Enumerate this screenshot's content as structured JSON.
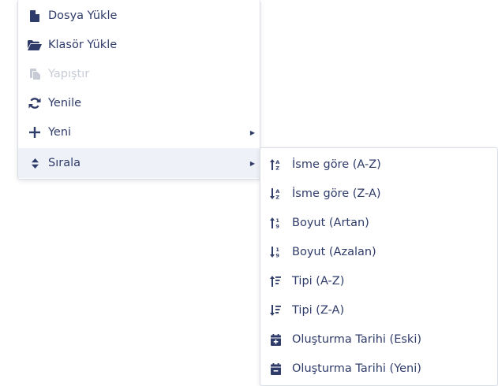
{
  "main_menu": {
    "items": [
      {
        "label": "Dosya Yükle",
        "icon": "file-icon"
      },
      {
        "label": "Klasör Yükle",
        "icon": "folder-open-icon"
      },
      {
        "label": "Yapıştır",
        "icon": "paste-icon",
        "disabled": true
      },
      {
        "label": "Yenile",
        "icon": "refresh-icon"
      },
      {
        "label": "Yeni",
        "icon": "plus-icon",
        "has_submenu": true
      },
      {
        "label": "Sırala",
        "icon": "sort-icon",
        "has_submenu": true,
        "active": true
      }
    ]
  },
  "sort_submenu": {
    "items": [
      {
        "label": "İsme göre (A-Z)",
        "icon": "sort-alpha-asc-icon"
      },
      {
        "label": "İsme göre (Z-A)",
        "icon": "sort-alpha-desc-icon"
      },
      {
        "label": "Boyut (Artan)",
        "icon": "sort-numeric-asc-icon"
      },
      {
        "label": "Boyut (Azalan)",
        "icon": "sort-numeric-desc-icon"
      },
      {
        "label": "Tipi (A-Z)",
        "icon": "sort-amount-asc-icon"
      },
      {
        "label": "Tipi (Z-A)",
        "icon": "sort-amount-desc-icon"
      },
      {
        "label": "Oluşturma Tarihi (Eski)",
        "icon": "calendar-plus-icon"
      },
      {
        "label": "Oluşturma Tarihi (Yeni)",
        "icon": "calendar-minus-icon"
      }
    ]
  },
  "colors": {
    "text": "#2f3b69",
    "disabled": "#c7cbd6",
    "active_bg": "#eef1f7",
    "border": "#d9dde6"
  }
}
